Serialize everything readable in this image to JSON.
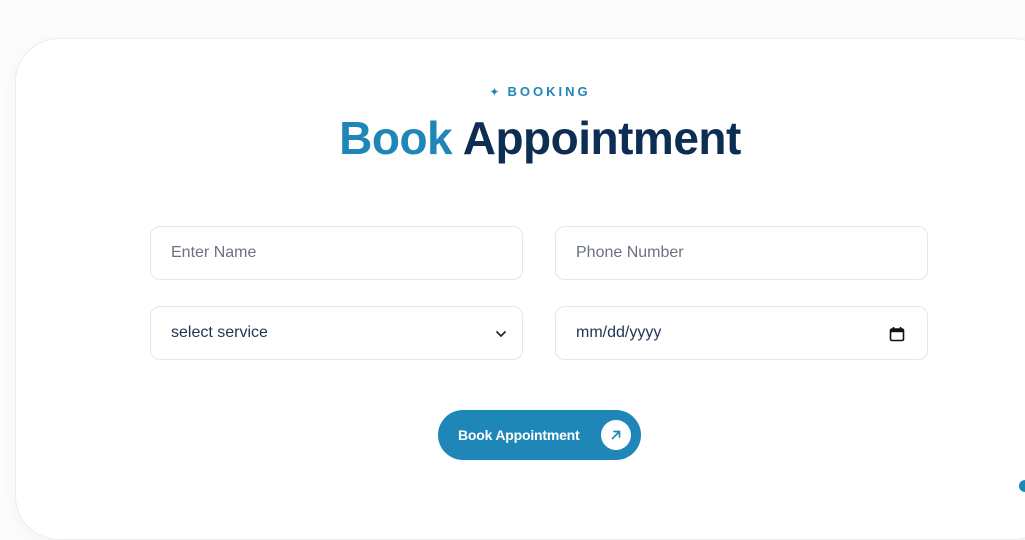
{
  "section": {
    "eyebrow_icon": "✦",
    "eyebrow": "BOOKING",
    "title_accent": "Book",
    "title_rest": "Appointment"
  },
  "form": {
    "name_placeholder": "Enter Name",
    "phone_placeholder": "Phone Number",
    "service_selected": "select service",
    "date_placeholder": "mm/dd/yyyy",
    "submit_label": "Book Appointment"
  },
  "icons": {
    "service_dropdown": "chevron-down-icon",
    "date_picker": "calendar-icon",
    "submit": "arrow-up-right-icon"
  },
  "colors": {
    "accent": "#1f86b8",
    "heading_dark": "#0e2d52"
  }
}
